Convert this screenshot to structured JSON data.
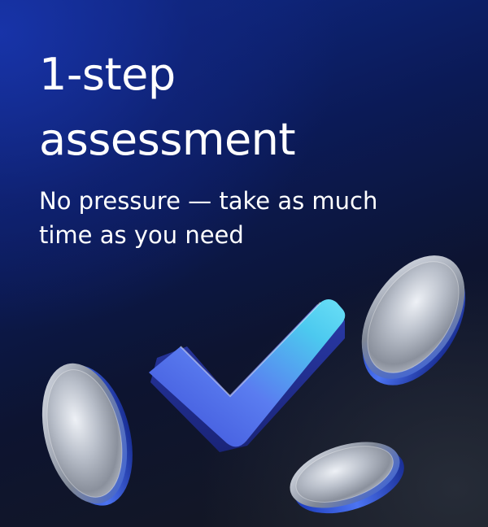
{
  "banner": {
    "title_line1": "1-step",
    "title_line2": "assessment",
    "subtitle": "No pressure — take as much time as you need"
  },
  "illustration": {
    "check_icon": "checkmark-icon",
    "coin_icon": "coin-icon",
    "colors": {
      "background_top": "#0f2a8c",
      "background_bottom": "#16181f",
      "checkmark_light": "#46d8f0",
      "checkmark_dark": "#2f47c9",
      "coin_rim": "#3a63e8",
      "coin_face": "#c9ced8"
    }
  }
}
